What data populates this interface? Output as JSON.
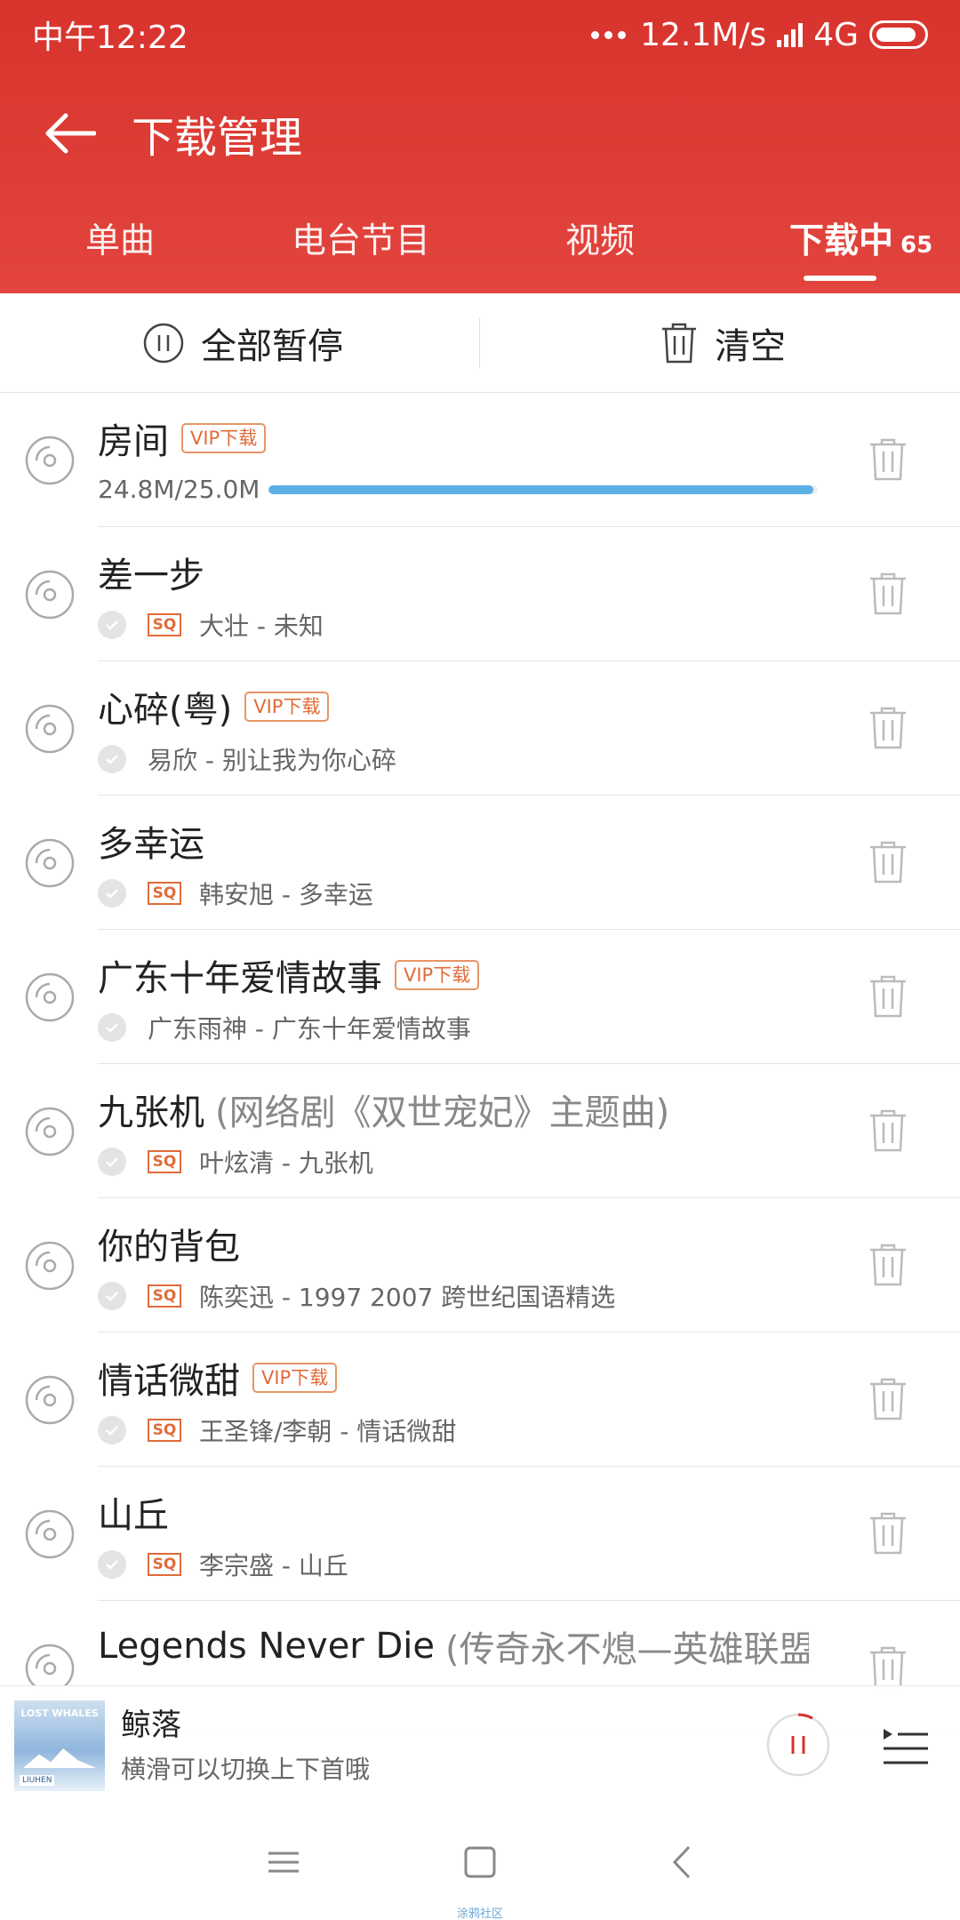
{
  "status_bar": {
    "time": "中午12:22",
    "speed": "12.1M/s",
    "network": "4G"
  },
  "titlebar": {
    "back_icon": "arrow-left-icon",
    "title": "下载管理"
  },
  "tabs": [
    {
      "label": "单曲",
      "active": false
    },
    {
      "label": "电台节目",
      "active": false
    },
    {
      "label": "视频",
      "active": false
    },
    {
      "label": "下载中",
      "count": "65",
      "active": true
    }
  ],
  "actions": {
    "pause_all": "全部暂停",
    "clear": "清空"
  },
  "downloading": {
    "title": "房间",
    "badge": "VIP下载",
    "progress_text": "24.8M/25.0M",
    "progress_fraction": 0.992
  },
  "items": [
    {
      "title": "差一步",
      "sq": "SQ",
      "meta": "大壮 - 未知"
    },
    {
      "title": "心碎(粤)",
      "badge": "VIP下载",
      "meta": "易欣 - 别让我为你心碎"
    },
    {
      "title": "多幸运",
      "sq": "SQ",
      "meta": "韩安旭 - 多幸运"
    },
    {
      "title": "广东十年爱情故事",
      "badge": "VIP下载",
      "meta": "广东雨神 - 广东十年爱情故事"
    },
    {
      "title": "九张机",
      "subtitle": "(网络剧《双世宠妃》主题曲)",
      "sq": "SQ",
      "meta": "叶炫清 - 九张机"
    },
    {
      "title": "你的背包",
      "sq": "SQ",
      "meta": "陈奕迅 - 1997 2007 跨世纪国语精选"
    },
    {
      "title": "情话微甜",
      "badge": "VIP下载",
      "sq": "SQ",
      "meta": "王圣锋/李朝 - 情话微甜"
    },
    {
      "title": "山丘",
      "sq": "SQ",
      "meta": "李宗盛 - 山丘"
    },
    {
      "title": "Legends Never Die",
      "subtitle": "(传奇永不熄—英雄联盟...",
      "meta": ""
    }
  ],
  "player": {
    "cover_text": "LOST WHALES",
    "cover_logo": "LIUHEN",
    "title": "鲸落",
    "hint": "横滑可以切换上下首哦"
  },
  "watermark": "涂鸦社区",
  "colors": {
    "header": "#d8332d",
    "accent_orange": "#e06b3a",
    "progress": "#5cb0e6"
  }
}
